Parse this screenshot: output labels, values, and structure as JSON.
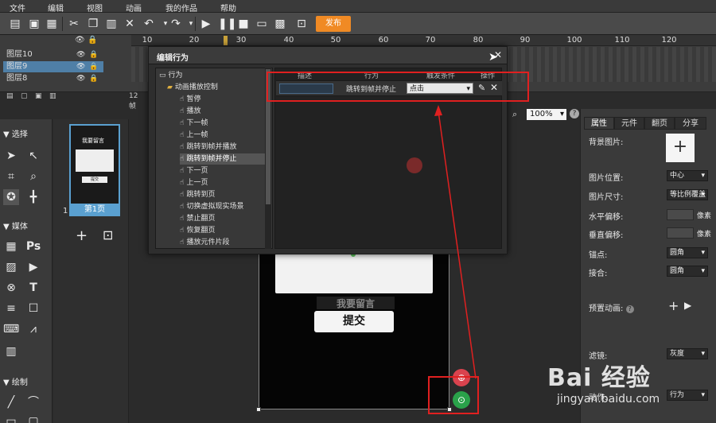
{
  "menu": [
    "文件",
    "编辑",
    "视图",
    "动画",
    "我的作品",
    "帮助"
  ],
  "toolbar": {
    "publish_label": "发布"
  },
  "ruler": [
    "10",
    "20",
    "30",
    "40",
    "50",
    "60",
    "70",
    "80",
    "90",
    "100",
    "110",
    "120"
  ],
  "layers": [
    {
      "name": "图层10",
      "selected": false
    },
    {
      "name": "图层9",
      "selected": true
    },
    {
      "name": "图层8",
      "selected": false
    }
  ],
  "timeline_info": "12 帧",
  "tools": {
    "select_title": "选择",
    "media_title": "媒体",
    "draw_title": "绘制"
  },
  "pages": {
    "label": "第1页",
    "number": "1",
    "thumb_title": "我要留言",
    "thumb_button": "提交"
  },
  "zoom": "100%",
  "stage": {
    "title": "我要留言",
    "submit": "提交"
  },
  "dialog": {
    "title": "编辑行为",
    "columns": [
      "描述",
      "行为",
      "触发条件",
      "操作"
    ],
    "tree_root": "行为",
    "tree_group": "动画播放控制",
    "tree_items": [
      "暂停",
      "播放",
      "下一帧",
      "上一帧",
      "跳转到帧并播放",
      "跳转到帧并停止",
      "下一页",
      "上一页",
      "跳转到页",
      "切换虚拟现实场景",
      "禁止翻页",
      "恢复翻页",
      "播放元件片段"
    ],
    "selected_index": 5,
    "row": {
      "action": "跳转到帧并停止",
      "trigger": "点击"
    }
  },
  "props": {
    "tabs": [
      "属性",
      "元件",
      "翻页",
      "分享"
    ],
    "bg_image": "背景图片:",
    "img_pos_label": "图片位置:",
    "img_pos_value": "中心",
    "img_size_label": "图片尺寸:",
    "img_size_value": "等比例覆盖",
    "h_offset_label": "水平偏移:",
    "v_offset_label": "垂直偏移:",
    "unit": "像素",
    "anchor_label": "锚点:",
    "anchor_value": "圆角",
    "blend_label": "接合:",
    "blend_value": "圆角",
    "preset_anim": "预置动画:",
    "filter_label": "滤镜:",
    "filter_value": "灰度",
    "action_label": "动作:",
    "action_value": "行为"
  },
  "watermark": {
    "main": "Bai 经验",
    "sub": "jingyan.baidu.com"
  },
  "colors": {
    "accent": "#f08a24",
    "selection": "#5aa0d0",
    "annotation": "#e02020"
  }
}
